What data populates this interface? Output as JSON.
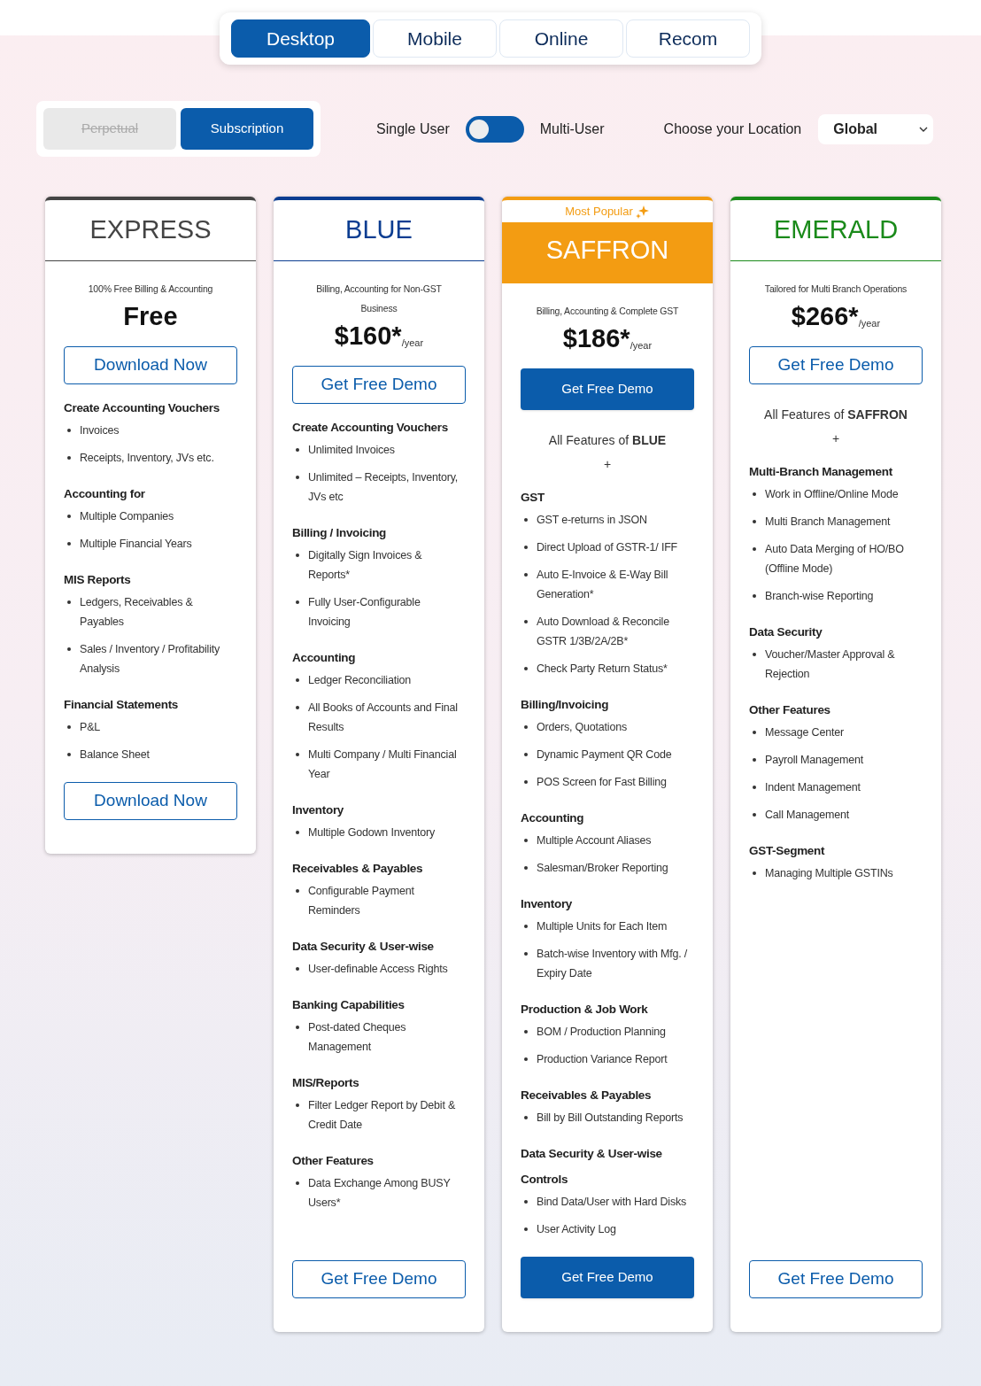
{
  "tabs": [
    {
      "label": "Desktop",
      "selected": true
    },
    {
      "label": "Mobile",
      "selected": false
    },
    {
      "label": "Online",
      "selected": false
    },
    {
      "label": "Recom",
      "selected": false
    }
  ],
  "license": [
    {
      "label": "Perpetual",
      "selected": false,
      "disabled": true
    },
    {
      "label": "Subscription",
      "selected": true,
      "disabled": false
    }
  ],
  "user_toggle": {
    "left_label": "Single User",
    "right_label": "Multi-User",
    "on": false
  },
  "location": {
    "label": "Choose your Location",
    "value": "Global"
  },
  "plans": [
    {
      "name": "EXPRESS",
      "color": "#444444",
      "highlighted": false,
      "tagline": "100% Free Billing & Accounting",
      "price": "Free",
      "top_button": "Download Now",
      "bottom_button": "Download Now",
      "sections": [
        {
          "heading": "Create Accounting Vouchers",
          "items": [
            "Invoices",
            "Receipts, Inventory, JVs etc."
          ]
        },
        {
          "heading": "Accounting for",
          "items": [
            "Multiple Companies",
            "Multiple Financial Years"
          ]
        },
        {
          "heading": "MIS Reports",
          "items": [
            "Ledgers, Receivables & Payables",
            "Sales / Inventory / Profitability Analysis"
          ]
        },
        {
          "heading": "Financial Statements",
          "items": [
            "P&L",
            "Balance Sheet"
          ]
        }
      ]
    },
    {
      "name": "BLUE",
      "color": "#0b3d91",
      "highlighted": false,
      "tagline": "Billing, Accounting for Non-GST Business",
      "price": "$160*",
      "per": "/year",
      "top_button": "Get Free Demo",
      "bottom_button": "Get Free Demo",
      "sections": [
        {
          "heading": "Create Accounting Vouchers",
          "items": [
            "Unlimited Invoices",
            "Unlimited – Receipts, Inventory, JVs etc"
          ]
        },
        {
          "heading": "Billing / Invoicing",
          "items": [
            "Digitally Sign Invoices & Reports*",
            "Fully User-Configurable Invoicing"
          ]
        },
        {
          "heading": "Accounting",
          "items": [
            "Ledger Reconciliation",
            "All Books of Accounts and Final Results",
            "Multi Company / Multi Financial Year"
          ]
        },
        {
          "heading": "Inventory",
          "items": [
            "Multiple Godown Inventory"
          ]
        },
        {
          "heading": "Receivables & Payables",
          "items": [
            "Configurable Payment Reminders"
          ]
        },
        {
          "heading": "Data Security & User-wise",
          "items": [
            "User-definable Access Rights"
          ]
        },
        {
          "heading": "Banking Capabilities",
          "items": [
            "Post-dated Cheques Management"
          ]
        },
        {
          "heading": "MIS/Reports",
          "items": [
            "Filter Ledger Report by Debit & Credit Date"
          ]
        },
        {
          "heading": "Other Features",
          "items": [
            "Data Exchange Among BUSY Users*"
          ]
        }
      ]
    },
    {
      "name": "SAFFRON",
      "color": "#f39c12",
      "highlighted": true,
      "badge": "Most Popular",
      "tagline": "Billing, Accounting & Complete GST",
      "price": "$186*",
      "per": "/year",
      "top_button": "Get Free Demo",
      "bottom_button": "Get Free Demo",
      "intro": "All Features of **BLUE**",
      "plus": "+",
      "sections": [
        {
          "heading": "GST",
          "items": [
            "GST e-returns in JSON",
            "Direct Upload of GSTR-1/ IFF",
            "Auto E-Invoice & E-Way Bill Generation*",
            "Auto Download & Reconcile GSTR 1/3B/2A/2B*",
            "Check Party Return Status*"
          ]
        },
        {
          "heading": "Billing/Invoicing",
          "items": [
            "Orders, Quotations",
            "Dynamic Payment QR Code",
            "POS Screen for Fast Billing"
          ]
        },
        {
          "heading": "Accounting",
          "items": [
            "Multiple Account Aliases",
            "Salesman/Broker Reporting"
          ]
        },
        {
          "heading": "Inventory",
          "items": [
            "Multiple Units for Each Item",
            "Batch-wise Inventory with Mfg. / Expiry Date"
          ]
        },
        {
          "heading": "Production & Job Work",
          "items": [
            "BOM / Production Planning",
            "Production Variance Report"
          ]
        },
        {
          "heading": "Receivables & Payables",
          "items": [
            "Bill by Bill Outstanding Reports"
          ]
        },
        {
          "heading": "Data Security & User-wise Controls",
          "items": [
            "Bind Data/User with Hard Disks",
            "User Activity Log"
          ]
        }
      ]
    },
    {
      "name": "EMERALD",
      "color": "#1a8a1a",
      "highlighted": false,
      "tagline": "Tailored for Multi Branch Operations",
      "price": "$266*",
      "per": "/year",
      "top_button": "Get Free Demo",
      "bottom_button": "Get Free Demo",
      "intro": "All Features of **SAFFRON**",
      "plus": "+",
      "sections": [
        {
          "heading": "Multi-Branch Management",
          "items": [
            "Work in Offline/Online Mode",
            "Multi Branch Management",
            "Auto Data Merging of HO/BO (Offline Mode)",
            "Branch-wise Reporting"
          ]
        },
        {
          "heading": "Data Security",
          "items": [
            "Voucher/Master Approval & Rejection"
          ]
        },
        {
          "heading": "Other Features",
          "items": [
            "Message Center",
            "Payroll Management",
            "Indent Management",
            "Call Management"
          ]
        },
        {
          "heading": "GST-Segment",
          "items": [
            "Managing Multiple GSTINs"
          ]
        }
      ]
    }
  ]
}
